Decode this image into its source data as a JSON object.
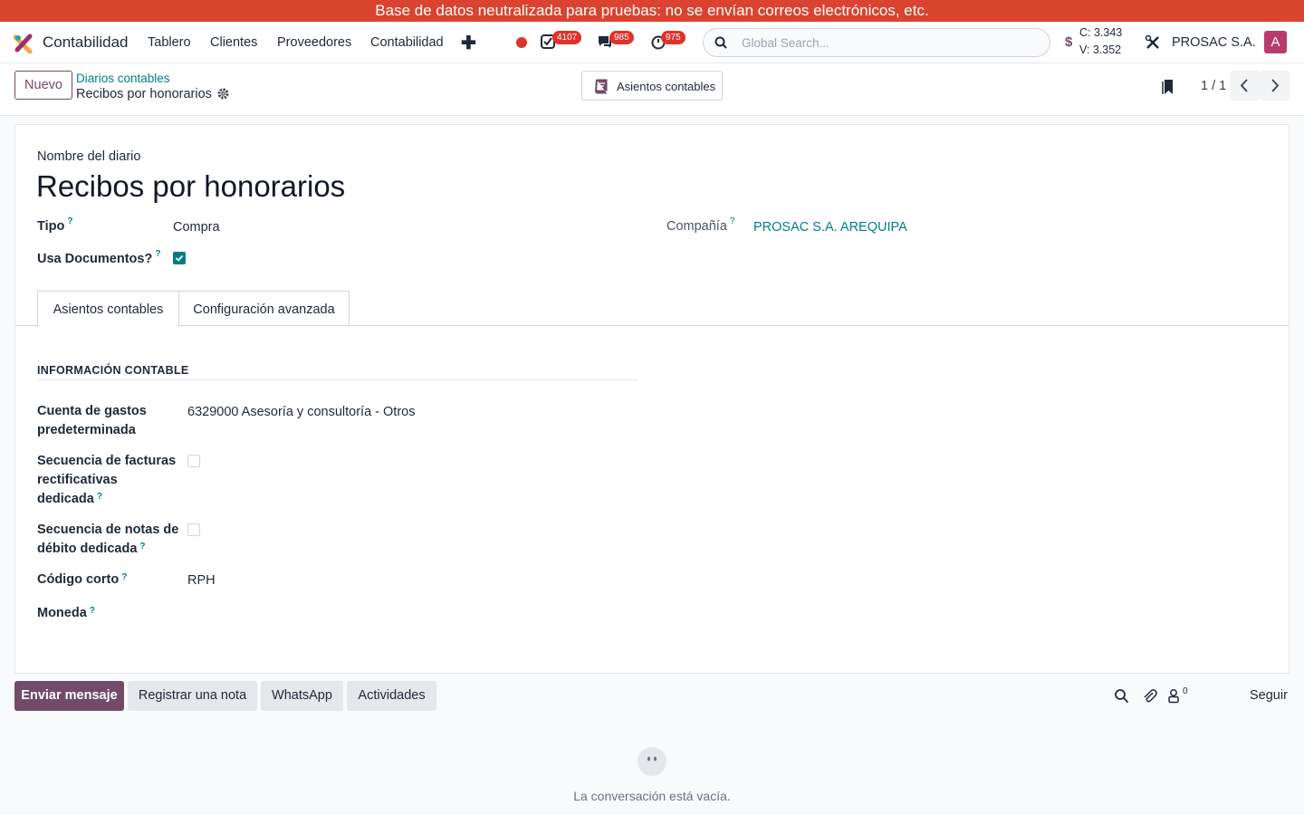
{
  "banner": {
    "text": "Base de datos neutralizada para pruebas: no se envían correos electrónicos, etc."
  },
  "navbar": {
    "app_name": "Contabilidad",
    "menu": [
      "Tablero",
      "Clientes",
      "Proveedores",
      "Contabilidad"
    ],
    "badges": {
      "activities": "4107",
      "messages": "985",
      "timers": "975"
    },
    "search_placeholder": "Global Search...",
    "currency_sign": "$",
    "rate_buy": "C: 3.343",
    "rate_sell": "V: 3.352",
    "company": "PROSAC S.A.",
    "avatar_letter": "A"
  },
  "control": {
    "new_label": "Nuevo",
    "breadcrumb_parent": "Diarios contables",
    "breadcrumb_current": "Recibos por honorarios",
    "smart_button": "Asientos contables",
    "pager": "1 / 1"
  },
  "form": {
    "name_label": "Nombre del diario",
    "name_value": "Recibos por honorarios",
    "tipo_label": "Tipo",
    "tipo_value": "Compra",
    "compania_label": "Compañía",
    "compania_value": "PROSAC S.A. AREQUIPA",
    "usa_docs_label": "Usa Documentos?",
    "usa_docs_checked": true,
    "tabs": [
      "Asientos contables",
      "Configuración avanzada"
    ],
    "group_title": "INFORMACIÓN CONTABLE",
    "cuenta_label": "Cuenta de gastos predeterminada",
    "cuenta_value": "6329000 Asesoría y consultoría - Otros",
    "sec_facturas_label": "Secuencia de facturas rectificativas dedicada",
    "sec_notas_label": "Secuencia de notas de débito dedicada",
    "codigo_label": "Código corto",
    "codigo_value": "RPH",
    "moneda_label": "Moneda",
    "help_mark": "?"
  },
  "chatter": {
    "send_message": "Enviar mensaje",
    "log_note": "Registrar una nota",
    "whatsapp": "WhatsApp",
    "activities": "Actividades",
    "followers_count": "0",
    "follow": "Seguir",
    "empty": "La conversación está vacía."
  },
  "colors": {
    "brand": "#714b67",
    "link": "#017e84",
    "banner": "#d9432f",
    "badge": "#e0322c"
  },
  "icons": [
    "app-logo-icon",
    "plus-icon",
    "record-icon",
    "activity-check-icon",
    "chat-icon",
    "timer-icon",
    "search-icon",
    "tools-icon",
    "gear-icon",
    "book-icon",
    "bookmark-icon",
    "chevron-left-icon",
    "chevron-right-icon",
    "paperclip-icon",
    "user-lock-icon",
    "empty-face-icon"
  ]
}
